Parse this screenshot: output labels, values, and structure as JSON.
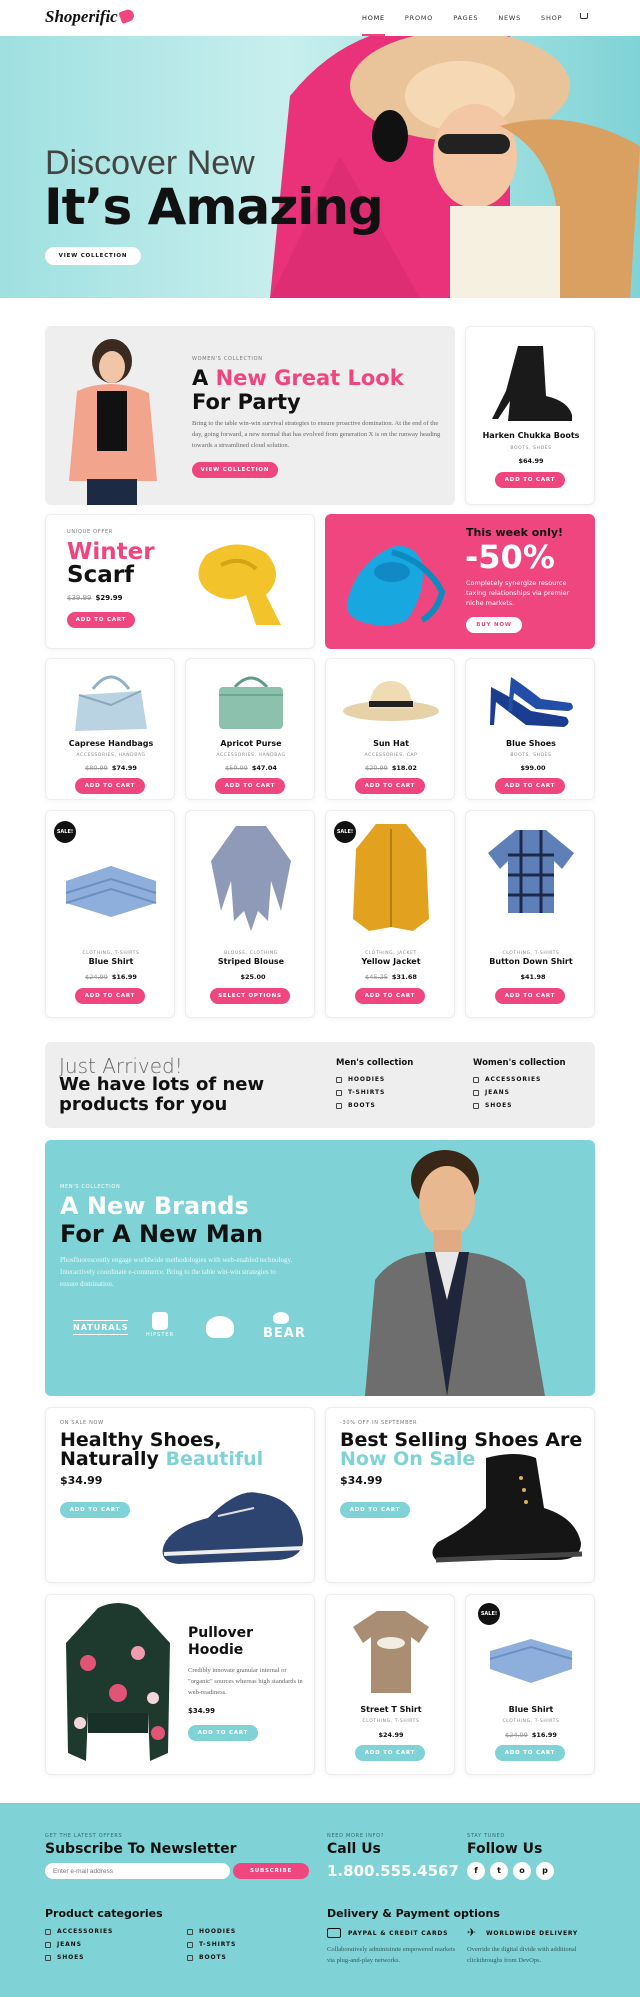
{
  "brand": "Shoperific",
  "nav": [
    "HOME",
    "PROMO",
    "PAGES",
    "NEWS",
    "SHOP"
  ],
  "colors": {
    "pink": "#f0467f",
    "teal": "#7fd3d6",
    "dark": "#111111"
  },
  "hero": {
    "line1": "Discover New",
    "line2": "It’s Amazing",
    "button": "VIEW COLLECTION"
  },
  "promo": {
    "eyebrow": "WOMEN'S COLLECTION",
    "title_a": "A ",
    "title_b": "New Great Look",
    "title_c": "For Party",
    "text": "Bring to the table win-win survival strategies to ensure proactive domination. At the end of the day, going forward, a new normal that has evolved from generation X is on the runway heading towards a streamlined cloud solution.",
    "button": "VIEW COLLECTION"
  },
  "boots": {
    "name": "Harken Chukka Boots",
    "tags": "BOOTS, SHOES",
    "price": "$64.99",
    "button": "ADD TO CART"
  },
  "scarf": {
    "eyebrow": "UNIQUE OFFER",
    "title1": "Winter",
    "title2": "Scarf",
    "old": "$39.99",
    "price": "$29.99",
    "button": "ADD TO CART"
  },
  "deal": {
    "title": "This week only!",
    "pct": "-50%",
    "text": "Completely synergize resource taxing relationships via premier niche markets.",
    "button": "BUY NOW"
  },
  "row1": [
    {
      "name": "Caprese Handbags",
      "tags": "ACCESSORIES, HANDBAG",
      "old": "$80.99",
      "price": "$74.99",
      "button": "ADD TO CART"
    },
    {
      "name": "Apricot Purse",
      "tags": "ACCESSORIES, HANDBAG",
      "old": "$50.99",
      "price": "$47.04",
      "button": "ADD TO CART"
    },
    {
      "name": "Sun Hat",
      "tags": "ACCESSORIES, CAP",
      "old": "$20.99",
      "price": "$18.02",
      "button": "ADD TO CART"
    },
    {
      "name": "Blue Shoes",
      "tags": "BOOTS, SHOES",
      "old": "",
      "price": "$99.00",
      "button": "ADD TO CART"
    }
  ],
  "row2": [
    {
      "name": "Blue Shirt",
      "tags": "CLOTHING, T-SHIRTS",
      "old": "$24.99",
      "price": "$16.99",
      "button": "ADD TO CART",
      "sale": "SALE!"
    },
    {
      "name": "Striped Blouse",
      "tags": "BLOUSE, CLOTHING",
      "old": "",
      "price": "$25.00",
      "button": "SELECT OPTIONS",
      "sale": ""
    },
    {
      "name": "Yellow Jacket",
      "tags": "CLOTHING, JACKET",
      "old": "$45.25",
      "price": "$31.68",
      "button": "ADD TO CART",
      "sale": "SALE!"
    },
    {
      "name": "Button Down Shirt",
      "tags": "CLOTHING, T-SHIRTS",
      "old": "",
      "price": "$41.98",
      "button": "ADD TO CART",
      "sale": ""
    }
  ],
  "arrived": {
    "line1": "Just Arrived!",
    "line2": "We have lots of new",
    "line3": "products for you",
    "men_title": "Men's collection",
    "men": [
      "HOODIES",
      "T-SHIRTS",
      "BOOTS"
    ],
    "women_title": "Women's collection",
    "women": [
      "ACCESSORIES",
      "JEANS",
      "SHOES"
    ]
  },
  "brands": {
    "eyebrow": "MEN'S COLLECTION",
    "title1": "A New Brands",
    "title2": "For A New Man",
    "text": "Phosfluorescently engage worldwide methodologies with web-enabled technology. Interactively coordinate e-commerce. Bring to the table win-win strategies to ensure domination.",
    "logos": [
      "NATURALS",
      "HIPSTER",
      "",
      "BEAR"
    ]
  },
  "shoes1": {
    "eyebrow": "ON SALE NOW",
    "t1": "Healthy Shoes,",
    "t2a": "Naturally ",
    "t2b": "Beautiful",
    "price": "$34.99",
    "button": "ADD TO CART"
  },
  "shoes2": {
    "eyebrow": "-30% OFF IN SEPTEMBER",
    "t1": "Best Selling Shoes Are",
    "t2": "Now On Sale",
    "price": "$34.99",
    "button": "ADD TO CART"
  },
  "hoodie": {
    "t1": "Pullover",
    "t2": "Hoodie",
    "text": "Credibly innovate granular internal or \"organic\" sources whereas high standards in web-readiness.",
    "price": "$34.99",
    "button": "ADD TO CART"
  },
  "tshirt": {
    "name": "Street T Shirt",
    "tags": "CLOTHING, T-SHIRTS",
    "price": "$24.99",
    "button": "ADD TO CART"
  },
  "shirt2": {
    "name": "Blue Shirt",
    "tags": "CLOTHING, T-SHIRTS",
    "old": "$24.99",
    "price": "$16.99",
    "button": "ADD TO CART",
    "sale": "SALE!"
  },
  "footer": {
    "news_eyebrow": "GET THE LATEST OFFERS",
    "news_title": "Subscribe To Newsletter",
    "email_ph": "Enter e-mail address",
    "subscribe": "SUBSCRIBE",
    "call_eyebrow": "NEED MORE INFO?",
    "call_title": "Call Us",
    "phone": "1.800.555.4567",
    "follow_eyebrow": "STAY TUNED",
    "follow_title": "Follow Us",
    "social": [
      "f",
      "t",
      "o",
      "p"
    ],
    "cat_title": "Product categories",
    "cats_a": [
      "ACCESSORIES",
      "JEANS",
      "SHOES"
    ],
    "cats_b": [
      "HOODIES",
      "T-SHIRTS",
      "BOOTS"
    ],
    "del_title": "Delivery & Payment options",
    "pay_title": "PAYPAL & CREDIT CARDS",
    "pay_text": "Collaboratively administrate empowered markets via plug-and-play networks.",
    "ww_title": "WORLDWIDE DELIVERY",
    "ww_text": "Override the digital divide with additional clickthroughs from DevOps."
  }
}
